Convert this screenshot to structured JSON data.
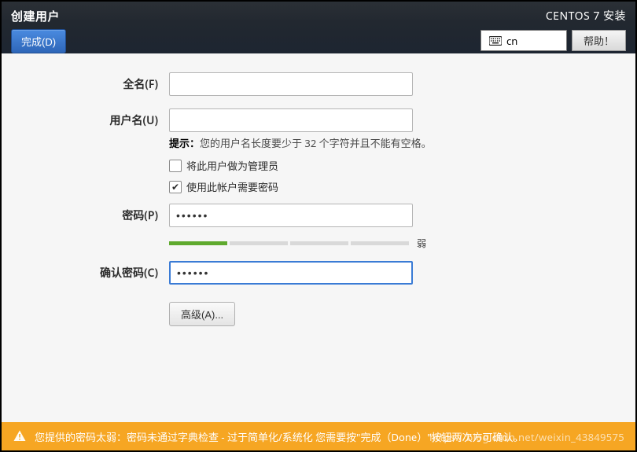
{
  "header": {
    "title": "创建用户",
    "done_label": "完成(D)",
    "install_title": "CENTOS 7 安装",
    "keyboard_indicator": "cn",
    "help_label": "帮助！"
  },
  "form": {
    "fullname_label": "全名(F)",
    "fullname_value": "",
    "username_label": "用户名(U)",
    "username_value": "",
    "hint_bold": "提示：",
    "hint_text": "您的用户名长度要少于 32 个字符并且不能有空格。",
    "admin_checkbox_label": "将此用户做为管理员",
    "admin_checked": false,
    "require_pw_checkbox_label": "使用此帐户需要密码",
    "require_pw_checked": true,
    "password_label": "密码(P)",
    "password_value": "••••••",
    "strength_label": "弱",
    "strength_segments_filled": 1,
    "confirm_label": "确认密码(C)",
    "confirm_value": "••••••",
    "advanced_label": "高级(A)..."
  },
  "warning": {
    "text": "您提供的密码太弱：密码未通过字典检查 - 过于简单化/系统化 您需要按\"完成（Done）\"按钮两次方可确认。"
  },
  "watermark": "https://blog.csdn.net/weixin_43849575"
}
